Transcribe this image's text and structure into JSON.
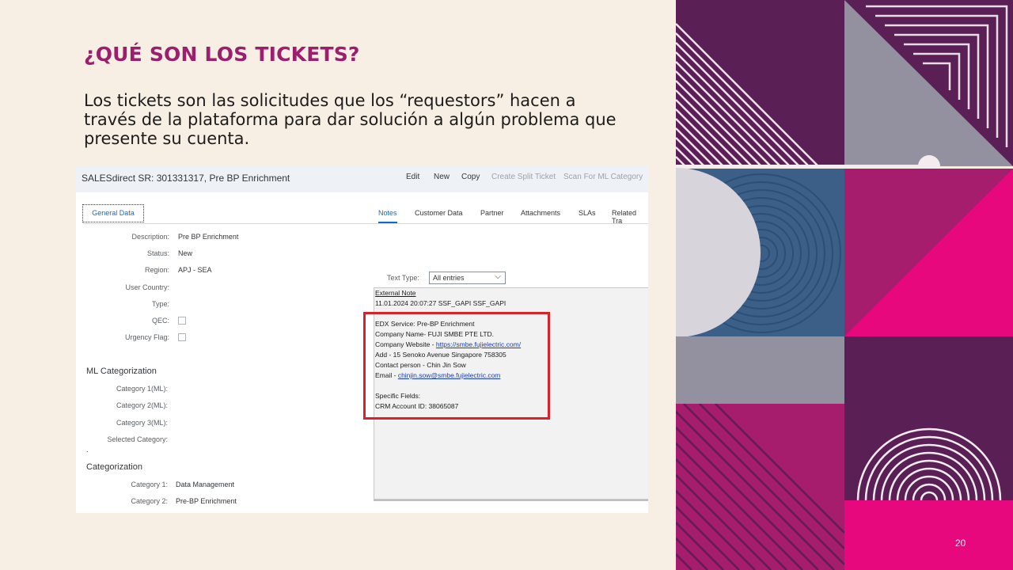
{
  "slide": {
    "title": "¿QUÉ SON LOS TICKETS?",
    "body": "Los tickets son las solicitudes que los “requestors” hacen a través de la plataforma para dar solución a algún problema que presente su cuenta.",
    "page_number": "20"
  },
  "screenshot": {
    "header_title": "SALESdirect SR: 301331317, Pre BP Enrichment",
    "toolbar": {
      "edit": "Edit",
      "new": "New",
      "copy": "Copy",
      "create_split": "Create Split Ticket",
      "scan": "Scan For ML Category"
    },
    "general_tab": "General Data",
    "fields": {
      "description_label": "Description:",
      "description_value": "Pre BP Enrichment",
      "status_label": "Status:",
      "status_value": "New",
      "region_label": "Region:",
      "region_value": "APJ - SEA",
      "user_country_label": "User Country:",
      "type_label": "Type:",
      "qec_label": "QEC:",
      "urgency_label": "Urgency Flag:"
    },
    "ml_section": {
      "title": "ML Categorization",
      "cat1": "Category 1(ML):",
      "cat2": "Category 2(ML):",
      "cat3": "Category 3(ML):",
      "selected": "Selected Category:"
    },
    "cat_section": {
      "title": "Categorization",
      "cat1_label": "Category 1:",
      "cat1_value": "Data Management",
      "cat2_label": "Category 2:",
      "cat2_value": "Pre-BP Enrichment"
    },
    "tabs": [
      "Notes",
      "Customer Data",
      "Partner",
      "Attachments",
      "SLAs",
      "Related Tra"
    ],
    "text_type": {
      "label": "Text Type:",
      "value": "All entries"
    },
    "note": {
      "heading": "External Note",
      "meta": "11.01.2024   20:07:27   SSF_GAPI SSF_GAPI",
      "service": "EDX Service: Pre-BP Enrichment",
      "company_name": "Company Name- FUJI SMBE PTE LTD.",
      "website_prefix": "Company Website - ",
      "website_link": "https://smbe.fujielectric.com/",
      "address": "Add - 15 Senoko Avenue Singapore 758305",
      "contact": "Contact person - Chin Jin Sow",
      "email_prefix": "Email - ",
      "email_link": "chinjin.sow@smbe.fujielectric.com",
      "specific": "Specific Fields:",
      "crm": "CRM Account ID: 38065087"
    }
  },
  "colors": {
    "title": "#9c1f6e",
    "background": "#f7efe4",
    "purple": "#5a1f55",
    "magenta": "#e8087e",
    "plum": "#a61d6e",
    "gray": "#93909f",
    "blue": "#3b5f86",
    "highlight": "#d7232a"
  }
}
